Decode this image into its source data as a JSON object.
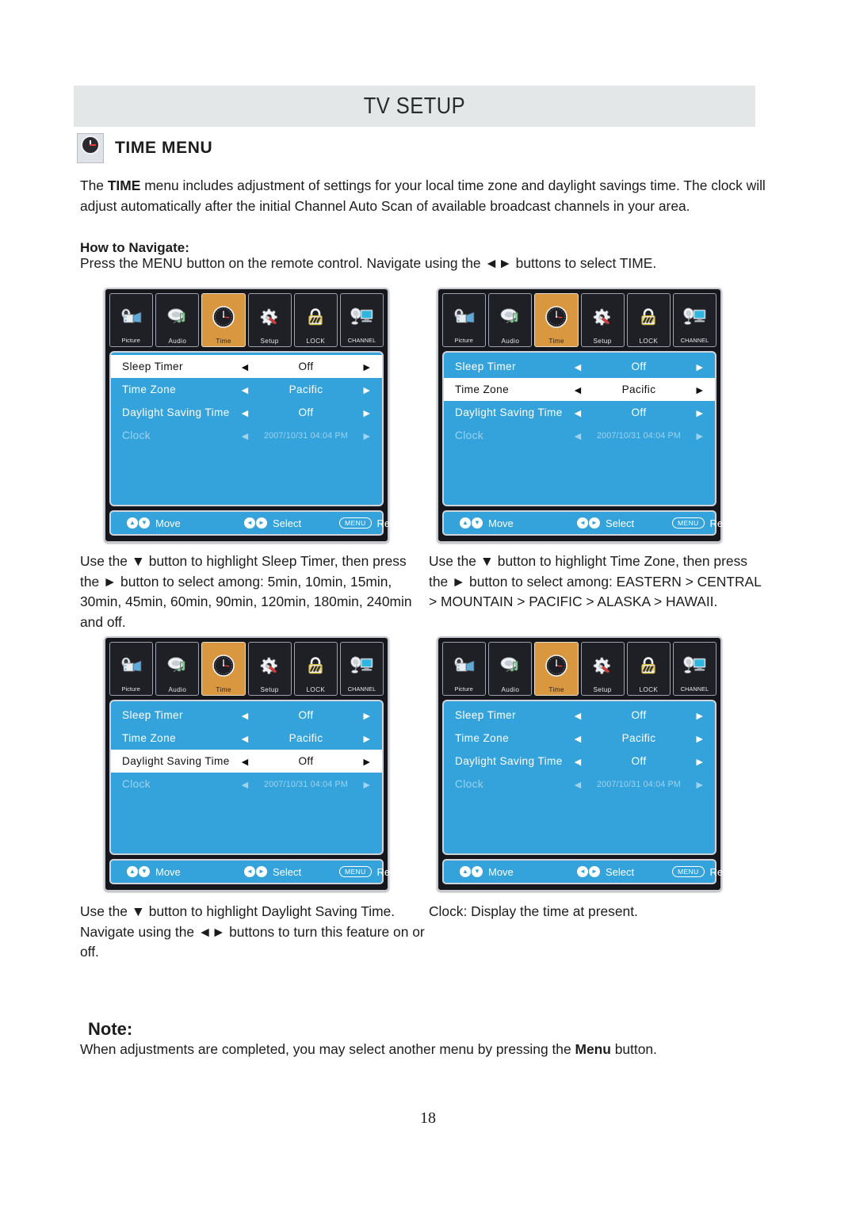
{
  "header": {
    "title": "TV SETUP"
  },
  "section": {
    "icon_name": "time-clock-icon",
    "icon_caption": "Time",
    "title": "TIME MENU"
  },
  "body": {
    "intro": "The TIME menu includes adjustment of settings for your local time zone and daylight savings time. The clock will adjust automatically after the initial Channel Auto Scan of available broadcast channels in your area.",
    "intro_bold_word": "TIME",
    "howto_label": "How to Navigate:",
    "howto_text": "Press the MENU button on the remote control. Navigate using the ◄► buttons to select TIME."
  },
  "captions": {
    "c1": "Use the ▼ button to highlight Sleep Timer, then press the ► button to select among: 5min, 10min, 15min, 30min, 45min, 60min, 90min, 120min, 180min, 240min and off.",
    "c2": "Use the ▼ button to highlight Time Zone, then press the ► button to select among: EASTERN > CENTRAL > MOUNTAIN > PACIFIC > ALASKA > HAWAII.",
    "c3": "Use the ▼ button to highlight Daylight Saving Time. Navigate using the ◄► buttons to turn this feature on or off.",
    "c4": "Clock: Display the time at present."
  },
  "note": {
    "label": "Note:",
    "text": "When adjustments are completed, you may select another menu by pressing the Menu button.",
    "bold_word": "Menu"
  },
  "page_number": "18",
  "colors": {
    "osd_blue": "#35a3db",
    "osd_active_tab": "#d9973f",
    "osd_frame_dark": "#15171c",
    "header_bg": "#e4e7e8"
  },
  "osd": {
    "tabs": [
      {
        "label": "Picture",
        "icon": "camcorder-icon",
        "active": false
      },
      {
        "label": "Audio",
        "icon": "speaker-note-icon",
        "active": false
      },
      {
        "label": "Time",
        "icon": "clock-icon",
        "active": true
      },
      {
        "label": "Setup",
        "icon": "gear-screwdriver-icon",
        "active": false
      },
      {
        "label": "LOCK",
        "icon": "padlock-icon",
        "active": false
      },
      {
        "label": "CHANNEL",
        "icon": "satellite-tv-icon",
        "active": false
      }
    ],
    "rows": [
      {
        "label": "Sleep Timer",
        "value": "Off",
        "left_arrow": "◄",
        "right_arrow": "►",
        "disabled": false
      },
      {
        "label": "Time Zone",
        "value": "Pacific",
        "left_arrow": "◄",
        "right_arrow": "►",
        "disabled": false
      },
      {
        "label": "Daylight Saving Time",
        "value": "Off",
        "left_arrow": "◄",
        "right_arrow": "►",
        "disabled": false
      },
      {
        "label": "Clock",
        "value": "2007/10/31 04:04 PM",
        "left_arrow": "◄",
        "right_arrow": "►",
        "disabled": true
      }
    ],
    "footer": {
      "move_label": "Move",
      "move_icon_up": "▲",
      "move_icon_down": "▼",
      "select_label": "Select",
      "select_icon_left": "◄",
      "select_icon_right": "►",
      "return_label": "Return",
      "return_key": "MENU"
    },
    "panels": [
      {
        "id": "panel-1",
        "selected_row": 0
      },
      {
        "id": "panel-2",
        "selected_row": 1
      },
      {
        "id": "panel-3",
        "selected_row": 2
      },
      {
        "id": "panel-4",
        "selected_row": -1
      }
    ]
  }
}
